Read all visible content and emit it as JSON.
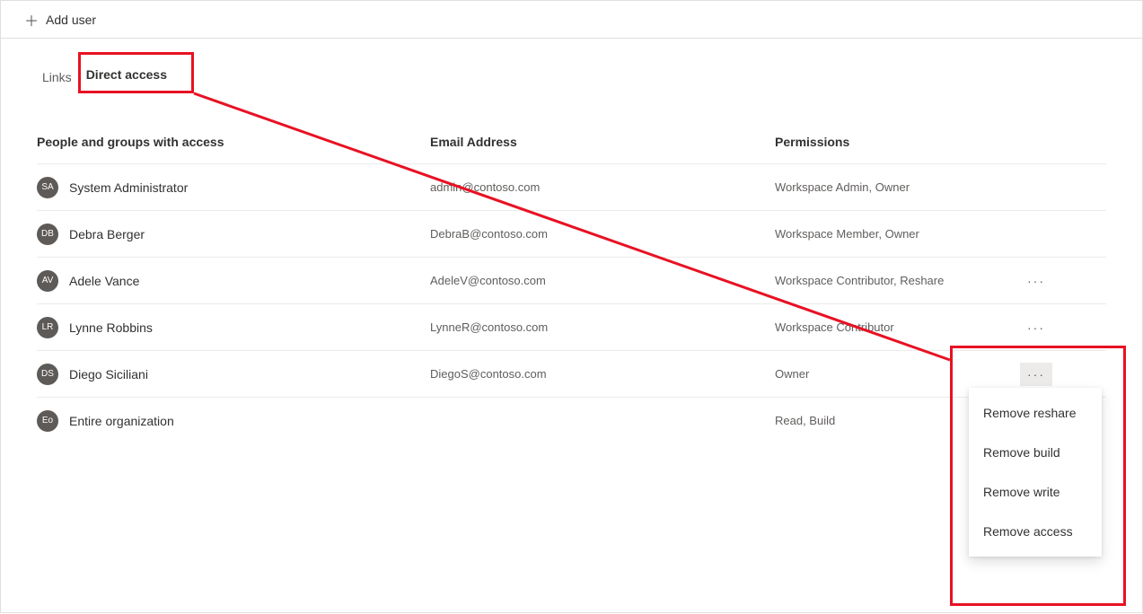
{
  "toolbar": {
    "add_user_label": "Add user"
  },
  "tabs": {
    "links_label": "Links",
    "direct_access_label": "Direct access",
    "active": "direct_access"
  },
  "columns": {
    "people": "People and groups with access",
    "email": "Email Address",
    "permissions": "Permissions"
  },
  "rows": [
    {
      "initials": "SA",
      "name": "System Administrator",
      "email": "admin@contoso.com",
      "permissions": "Workspace Admin, Owner",
      "has_more": false
    },
    {
      "initials": "DB",
      "name": "Debra Berger",
      "email": "DebraB@contoso.com",
      "permissions": "Workspace Member, Owner",
      "has_more": false
    },
    {
      "initials": "AV",
      "name": "Adele Vance",
      "email": "AdeleV@contoso.com",
      "permissions": "Workspace Contributor, Reshare",
      "has_more": true
    },
    {
      "initials": "LR",
      "name": "Lynne Robbins",
      "email": "LynneR@contoso.com",
      "permissions": "Workspace Contributor",
      "has_more": true
    },
    {
      "initials": "DS",
      "name": "Diego Siciliani",
      "email": "DiegoS@contoso.com",
      "permissions": "Owner",
      "has_more": true,
      "more_active": true
    },
    {
      "initials": "Eo",
      "name": "Entire organization",
      "email": "",
      "permissions": "Read, Build",
      "has_more": false
    }
  ],
  "context_menu": {
    "items": [
      "Remove reshare",
      "Remove build",
      "Remove write",
      "Remove access"
    ]
  }
}
